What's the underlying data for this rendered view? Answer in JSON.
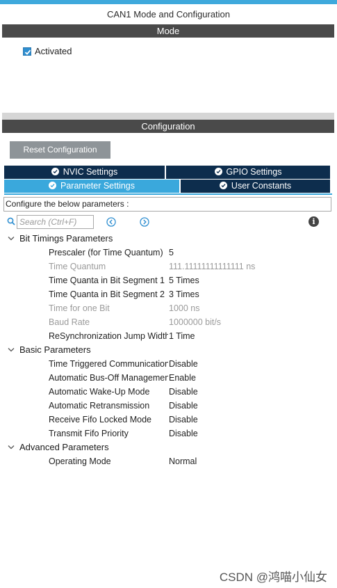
{
  "window": {
    "title": "CAN1 Mode and Configuration"
  },
  "mode": {
    "header": "Mode",
    "activated": {
      "label": "Activated",
      "checked": true
    }
  },
  "configuration": {
    "header": "Configuration",
    "reset_label": "Reset Configuration",
    "tabs": [
      {
        "label": "NVIC Settings",
        "active": false
      },
      {
        "label": "GPIO Settings",
        "active": false
      },
      {
        "label": "Parameter Settings",
        "active": true
      },
      {
        "label": "User Constants",
        "active": false
      }
    ],
    "description": "Configure the below parameters :",
    "search": {
      "placeholder": "Search (Ctrl+F)"
    }
  },
  "groups": [
    {
      "title": "Bit Timings Parameters",
      "params": [
        {
          "name": "Prescaler (for Time Quantum)",
          "value": "5",
          "muted": false
        },
        {
          "name": "Time Quantum",
          "value": "111.11111111111111 ns",
          "muted": true
        },
        {
          "name": "Time Quanta in Bit Segment 1",
          "value": "5 Times",
          "muted": false
        },
        {
          "name": "Time Quanta in Bit Segment 2",
          "value": "3 Times",
          "muted": false
        },
        {
          "name": "Time for one Bit",
          "value": "1000 ns",
          "muted": true
        },
        {
          "name": "Baud Rate",
          "value": "1000000 bit/s",
          "muted": true
        },
        {
          "name": "ReSynchronization Jump Width",
          "value": "1 Time",
          "muted": false
        }
      ]
    },
    {
      "title": "Basic Parameters",
      "params": [
        {
          "name": "Time Triggered Communication Mode",
          "value": "Disable",
          "muted": false
        },
        {
          "name": "Automatic Bus-Off Management",
          "value": "Enable",
          "muted": false
        },
        {
          "name": "Automatic Wake-Up Mode",
          "value": "Disable",
          "muted": false
        },
        {
          "name": "Automatic Retransmission",
          "value": "Disable",
          "muted": false
        },
        {
          "name": "Receive Fifo Locked Mode",
          "value": "Disable",
          "muted": false
        },
        {
          "name": "Transmit Fifo Priority",
          "value": "Disable",
          "muted": false
        }
      ]
    },
    {
      "title": "Advanced Parameters",
      "params": [
        {
          "name": "Operating Mode",
          "value": "Normal",
          "muted": false
        }
      ]
    }
  ],
  "watermark": "CSDN @鸿喵小仙女",
  "colors": {
    "accent": "#3aa8dc",
    "tab_dark": "#0d2d4d",
    "header_gray": "#4a4a4a"
  }
}
